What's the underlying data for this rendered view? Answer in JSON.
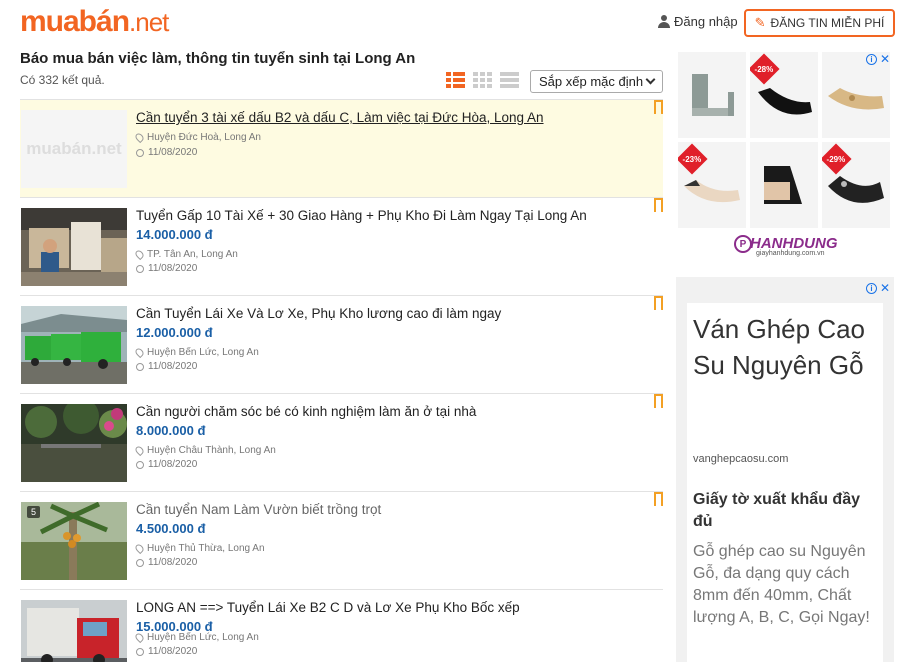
{
  "header": {
    "logo_main": "muabán",
    "logo_tld": ".net",
    "login_label": "Đăng nhập",
    "post_button_label": "ĐĂNG TIN MIỄN PHÍ"
  },
  "page": {
    "title": "Báo mua bán việc làm, thông tin tuyển sinh tại Long An",
    "result_count": "Có 332 kết quả.",
    "sort_selected": "Sắp xếp mặc định",
    "active_view": "list"
  },
  "listings": [
    {
      "title": "Cần tuyển 3 tài xế dấu B2 và dấu C, Làm việc tại Đức Hòa, Long An",
      "price": "",
      "location": "Huyện Đức Hoà, Long An",
      "date": "11/08/2020",
      "thumb": "placeholder",
      "placeholder_text": "muabán.net",
      "highlighted": true
    },
    {
      "title": "Tuyển Gấp 10 Tài Xế + 30 Giao Hàng + Phụ Kho Đi Làm Ngay Tại Long An",
      "price": "14.000.000 đ",
      "location": "TP. Tân An, Long An",
      "date": "11/08/2020",
      "thumb": "warehouse"
    },
    {
      "title": "Cần Tuyển Lái Xe Và Lơ Xe, Phụ Kho lương cao đi làm ngay",
      "price": "12.000.000 đ",
      "location": "Huyện Bến Lức, Long An",
      "date": "11/08/2020",
      "thumb": "trucks"
    },
    {
      "title": "Cần người chăm sóc bé có kinh nghiệm làm ăn ở tại nhà",
      "price": "8.000.000 đ",
      "location": "Huyện Châu Thành, Long An",
      "date": "11/08/2020",
      "thumb": "garden"
    },
    {
      "title": "Cần tuyển Nam Làm Vườn biết trồng trọt",
      "price": "4.500.000 đ",
      "location": "Huyện Thủ Thừa, Long An",
      "date": "11/08/2020",
      "thumb": "palm",
      "photo_count": "5"
    },
    {
      "title": "LONG AN ==> Tuyển Lái Xe B2 C D và Lơ Xe Phụ Kho Bốc xếp",
      "price": "15.000.000 đ",
      "location": "Huyện Bến Lức, Long An",
      "date": "11/08/2020",
      "thumb": "redtruck"
    }
  ],
  "ad_shoes": {
    "discounts": [
      "",
      "-28%",
      "",
      "-23%",
      "",
      "-29%"
    ],
    "brand_name": "HANHDUNG",
    "brand_url": "giayhanhdung.com.vn"
  },
  "ad_text": {
    "headline": "Ván Ghép Cao Su Nguyên Gỗ",
    "url": "vanghepcaosu.com",
    "subhead": "Giấy tờ xuất khẩu đầy đủ",
    "body": "Gỗ ghép cao su Nguyên Gỗ, đa dạng quy cách 8mm đến 40mm, Chất lượng A, B, C, Gọi Ngay!"
  },
  "colors": {
    "brand_orange": "#f26522",
    "price_blue": "#1a5fa6",
    "highlight_bg": "#fefbe1",
    "bookmark": "#f3a024"
  }
}
